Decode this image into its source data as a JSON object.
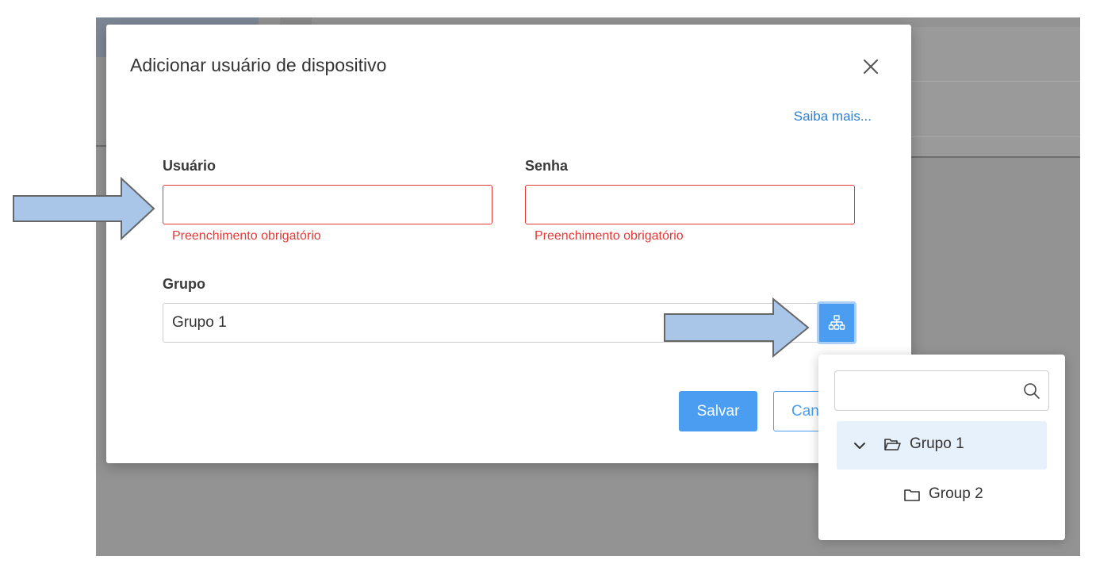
{
  "modal": {
    "title": "Adicionar usuário de dispositivo",
    "learn_more": "Saiba mais...",
    "username": {
      "label": "Usuário",
      "value": "",
      "error": "Preenchimento obrigatório"
    },
    "password": {
      "label": "Senha",
      "value": "",
      "error": "Preenchimento obrigatório"
    },
    "group": {
      "label": "Grupo",
      "value": "Grupo 1"
    },
    "save_label": "Salvar",
    "cancel_label": "Can"
  },
  "group_dropdown": {
    "search_value": "",
    "nodes": [
      {
        "label": "Grupo 1",
        "expanded": true,
        "selected": true
      },
      {
        "label": "Group 2",
        "expanded": false,
        "selected": false
      }
    ]
  },
  "icons": {
    "close": "close-icon",
    "tree": "hierarchy-icon",
    "search": "search-icon",
    "chevron": "chevron-down-icon",
    "open_folder": "folder-open-icon",
    "folder": "folder-icon"
  },
  "colors": {
    "accent": "#4a9df0",
    "error": "#e53935",
    "link": "#2f7fd1",
    "annotation_arrow_fill": "#a9c6e8"
  }
}
